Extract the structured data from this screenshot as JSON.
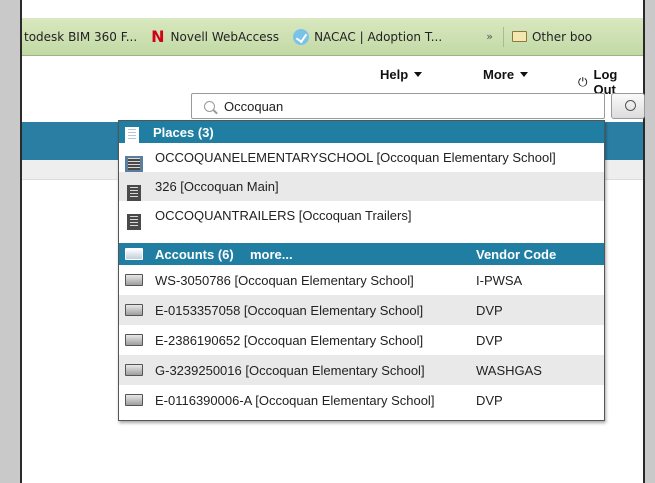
{
  "bookmarks": {
    "items": [
      {
        "label": "todesk BIM 360 F..."
      },
      {
        "label": "Novell WebAccess",
        "icon": "novell-n-icon"
      },
      {
        "label": "NACAC | Adoption T...",
        "icon": "nacac-icon"
      }
    ],
    "overflow": "»",
    "folder": "Other boo"
  },
  "nav": {
    "help": "Help",
    "more": "More",
    "logout": "Log Out",
    "logout_icon": "⏻"
  },
  "search": {
    "value": "Occoquan"
  },
  "dropdown": {
    "places_header": "Places (3)",
    "places": [
      {
        "label": "OCCOQUANELEMENTARYSCHOOL [Occoquan Elementary School]"
      },
      {
        "label": "326 [Occoquan Main]"
      },
      {
        "label": "OCCOQUANTRAILERS [Occoquan Trailers]"
      }
    ],
    "accounts_header": "Accounts (6)",
    "accounts_more": "more...",
    "vendor_header": "Vendor Code",
    "accounts": [
      {
        "label": "WS-3050786 [Occoquan Elementary School]",
        "vendor": "I-PWSA"
      },
      {
        "label": "E-0153357058 [Occoquan Elementary School]",
        "vendor": "DVP"
      },
      {
        "label": "E-2386190652 [Occoquan Elementary School]",
        "vendor": "DVP"
      },
      {
        "label": "G-3239250016 [Occoquan Elementary School]",
        "vendor": "WASHGAS"
      },
      {
        "label": "E-0116390006-A [Occoquan Elementary School]",
        "vendor": "DVP"
      }
    ]
  },
  "colors": {
    "header_blue": "#1f7ea2",
    "bookmark_bar": "#c9ddb0",
    "row_alt": "#e9e9e9"
  }
}
